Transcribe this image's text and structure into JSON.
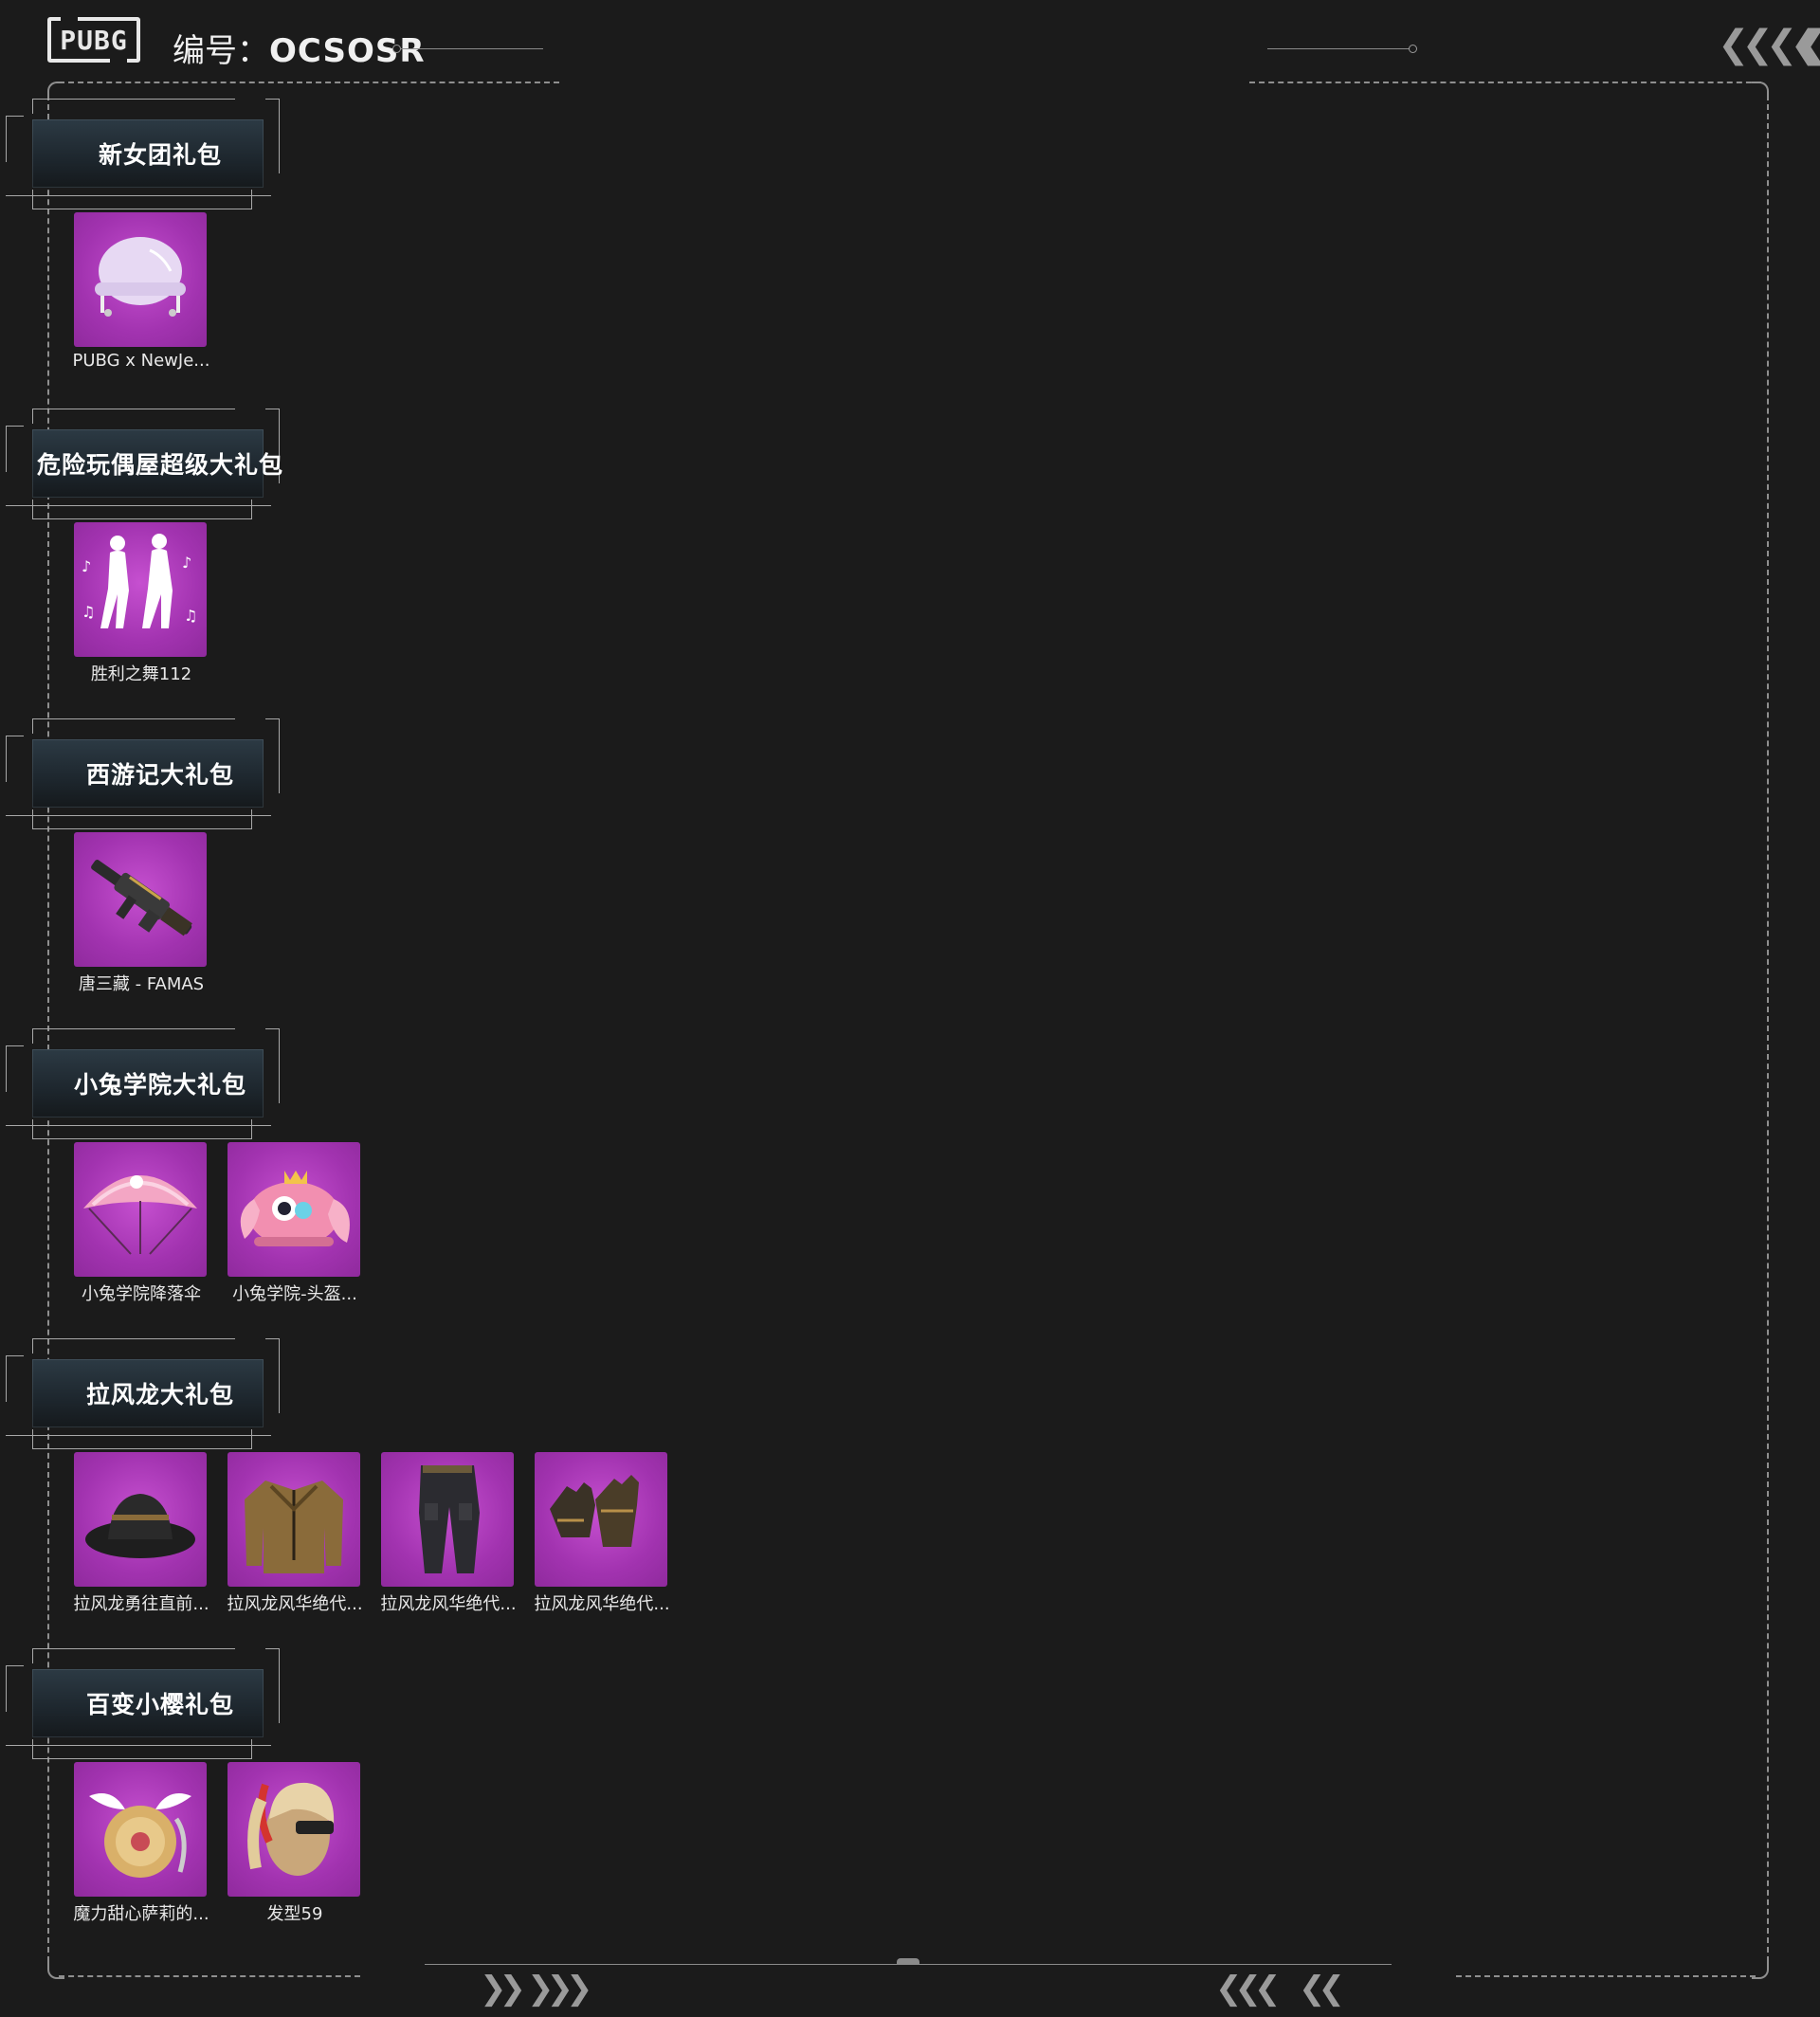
{
  "header": {
    "logo_text": "PUBG",
    "serial_prefix": "编号：",
    "serial_code": "OCSOSR"
  },
  "sections": [
    {
      "title": "新女团礼包",
      "items": [
        {
          "name": "PUBG x NewJe...",
          "icon": "helmet-icon"
        }
      ]
    },
    {
      "title": "危险玩偶屋超级大礼包",
      "items": [
        {
          "name": "胜利之舞112",
          "icon": "dance-emote-icon"
        }
      ]
    },
    {
      "title": "西游记大礼包",
      "items": [
        {
          "name": "唐三藏 - FAMAS",
          "icon": "rifle-icon"
        }
      ]
    },
    {
      "title": "小兔学院大礼包",
      "items": [
        {
          "name": "小兔学院降落伞",
          "icon": "parachute-icon"
        },
        {
          "name": "小兔学院-头盔...",
          "icon": "bunny-helmet-icon"
        }
      ]
    },
    {
      "title": "拉风龙大礼包",
      "items": [
        {
          "name": "拉风龙勇往直前...",
          "icon": "bucket-hat-icon"
        },
        {
          "name": "拉风龙风华绝代...",
          "icon": "jacket-icon"
        },
        {
          "name": "拉风龙风华绝代...",
          "icon": "pants-icon"
        },
        {
          "name": "拉风龙风华绝代...",
          "icon": "gloves-icon"
        }
      ]
    },
    {
      "title": "百变小樱礼包",
      "items": [
        {
          "name": "魔力甜心萨莉的...",
          "icon": "winged-backpack-icon"
        },
        {
          "name": "发型59",
          "icon": "hairstyle-icon"
        }
      ]
    }
  ],
  "colors": {
    "background": "#1b1b1b",
    "tile_purple": "#a233b0",
    "frame_line": "#8f8f8f"
  }
}
